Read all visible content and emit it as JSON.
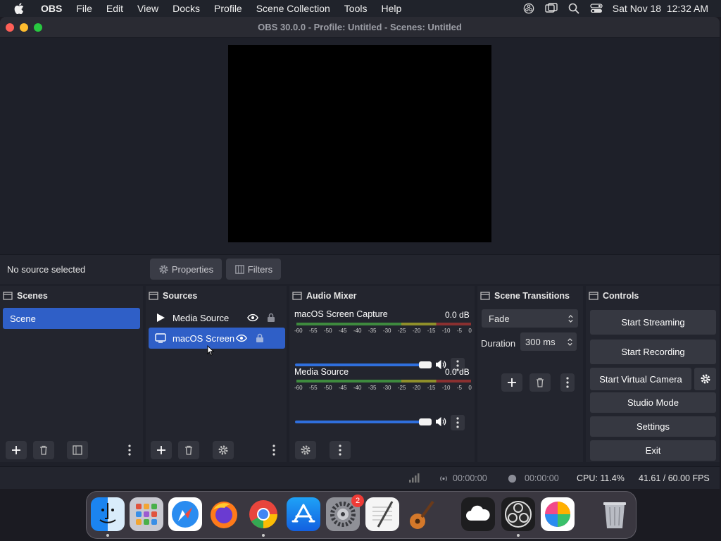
{
  "menubar": {
    "items": [
      "OBS",
      "File",
      "Edit",
      "View",
      "Docks",
      "Profile",
      "Scene Collection",
      "Tools",
      "Help"
    ],
    "datetime": "Sat Nov 18  12:32 AM"
  },
  "window": {
    "title": "OBS 30.0.0 - Profile: Untitled - Scenes: Untitled"
  },
  "source_toolbar": {
    "no_source": "No source selected",
    "properties": "Properties",
    "filters": "Filters"
  },
  "scenes": {
    "header": "Scenes",
    "items": [
      "Scene"
    ]
  },
  "sources": {
    "header": "Sources",
    "items": [
      "Media Source",
      "macOS Screen"
    ]
  },
  "mixer": {
    "header": "Audio Mixer",
    "ticks": [
      "-60",
      "-55",
      "-50",
      "-45",
      "-40",
      "-35",
      "-30",
      "-25",
      "-20",
      "-15",
      "-10",
      "-5",
      "0"
    ],
    "channels": [
      {
        "name": "macOS Screen Capture",
        "db": "0.0 dB",
        "level": 1.0
      },
      {
        "name": "Media Source",
        "db": "0.0 dB",
        "level": 1.0
      }
    ]
  },
  "transitions": {
    "header": "Scene Transitions",
    "selected": "Fade",
    "duration_label": "Duration",
    "duration": "300 ms"
  },
  "controls": {
    "header": "Controls",
    "start_streaming": "Start Streaming",
    "start_recording": "Start Recording",
    "start_virtual_camera": "Start Virtual Camera",
    "studio_mode": "Studio Mode",
    "settings": "Settings",
    "exit": "Exit"
  },
  "status": {
    "stream_time": "00:00:00",
    "record_time": "00:00:00",
    "cpu": "CPU: 11.4%",
    "fps": "41.61 / 60.00 FPS"
  },
  "dock": {
    "settings_badge": "2"
  },
  "colors": {
    "accent": "#2f5fc7",
    "panel": "#23252e",
    "button": "#363841"
  }
}
